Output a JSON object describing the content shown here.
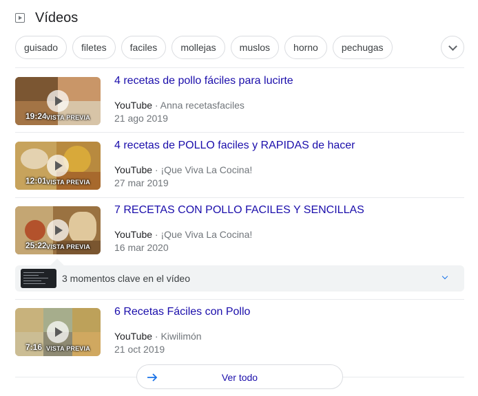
{
  "section": {
    "title": "Vídeos",
    "icon": "video-play-icon"
  },
  "chips": [
    "guisado",
    "filetes",
    "faciles",
    "mollejas",
    "muslos",
    "horno",
    "pechugas"
  ],
  "videos": [
    {
      "title": "4 recetas de pollo fáciles para lucirte",
      "source": "YouTube",
      "channel": "· Anna recetasfaciles",
      "date": "21 ago 2019",
      "duration": "19:24",
      "preview": "VISTA PREVIA"
    },
    {
      "title": "4 recetas de POLLO faciles y RAPIDAS de hacer",
      "source": "YouTube",
      "channel": "· ¡Que Viva La Cocina!",
      "date": "27 mar 2019",
      "duration": "12:01",
      "preview": "VISTA PREVIA"
    },
    {
      "title": "7 RECETAS CON POLLO FACILES Y SENCILLAS",
      "source": "YouTube",
      "channel": "· ¡Que Viva La Cocina!",
      "date": "16 mar 2020",
      "duration": "25:22",
      "preview": "VISTA PREVIA"
    },
    {
      "title": "6 Recetas Fáciles con Pollo",
      "source": "YouTube",
      "channel": "· Kiwilimón",
      "date": "21 oct 2019",
      "duration": "7:16",
      "preview": "VISTA PREVIA"
    }
  ],
  "key_moments": {
    "label": "3 momentos clave en el vídeo"
  },
  "footer": {
    "label": "Ver todo"
  },
  "colors": {
    "link": "#1a0dab",
    "accent": "#1a73e8",
    "meta": "#70757a"
  }
}
